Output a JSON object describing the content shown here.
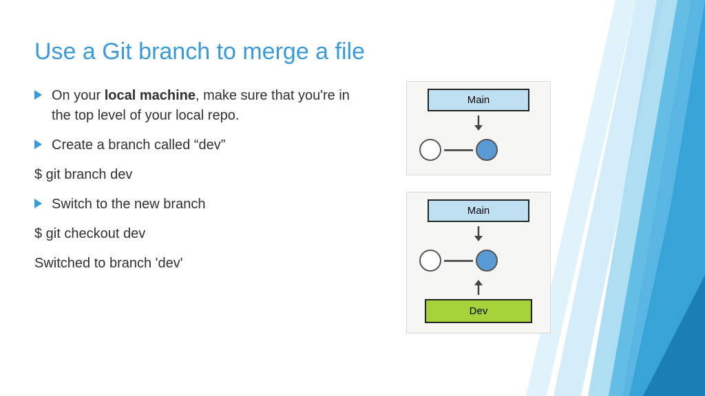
{
  "title": "Use a Git branch to merge a file",
  "bullets": {
    "b1_pre": "On your ",
    "b1_bold": "local machine",
    "b1_post": ", make sure that you're in the top level of your local repo.",
    "b2": "Create a branch called “dev”",
    "b3": "Switch to the new branch"
  },
  "commands": {
    "c1": "$ git branch dev",
    "c2": "$ git checkout dev"
  },
  "outputs": {
    "o1": "Switched to branch 'dev'"
  },
  "diagram": {
    "main_label": "Main",
    "dev_label": "Dev"
  }
}
